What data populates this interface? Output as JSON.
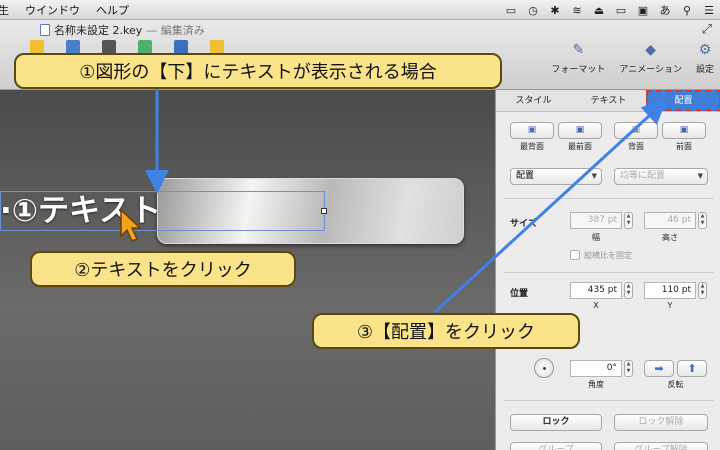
{
  "menubar": {
    "items": [
      "生",
      "ウインドウ",
      "ヘルプ"
    ],
    "status": [
      "▭",
      "◷",
      "✱",
      "≋",
      "⏏",
      "▭",
      "▣",
      "あ",
      "⚲",
      "☰"
    ]
  },
  "window": {
    "doc_title": "名称未設定 2.key",
    "edited": "— 編集済み",
    "fullscreen_glyph": "⤢"
  },
  "toolbar": {
    "left_icon_colors": [
      "#f0c030",
      "#4a7fd0",
      "#555555",
      "#4fb06a",
      "#3a6fc0",
      "#f0c030"
    ],
    "format_label": "フォーマット",
    "animation_label": "アニメーション",
    "settings_label": "設定",
    "format_icon": "✎",
    "animation_icon": "◆",
    "settings_icon": "⚙"
  },
  "canvas": {
    "shape_text": "·①テキスト"
  },
  "panel": {
    "tabs": [
      "スタイル",
      "テキスト",
      "配置"
    ],
    "active_tab": 2,
    "order": {
      "back_label": "最背面",
      "backward_label": "最前面",
      "forward_label": "背面",
      "front_label": "前面"
    },
    "align_dropdown": "配置",
    "distribute_dropdown": "均等に配置",
    "size": {
      "label": "サイズ",
      "width_value": "387 pt",
      "height_value": "46 pt",
      "width_caption": "幅",
      "height_caption": "高さ",
      "constrain_label": "縦横比を固定"
    },
    "position": {
      "label": "位置",
      "x_value": "435 pt",
      "y_value": "110 pt",
      "x_caption": "X",
      "y_caption": "Y"
    },
    "rotate": {
      "angle_value": "0°",
      "angle_caption": "角度",
      "flip_caption": "反転"
    },
    "lock_label": "ロック",
    "unlock_label": "ロック解除",
    "group_label": "グループ",
    "ungroup_label": "グループ解除"
  },
  "callouts": {
    "c1": "①図形の【下】にテキストが表示される場合",
    "c2": "②テキストをクリック",
    "c3": "③【配置】をクリック"
  },
  "colors": {
    "callout_bg": "#fbe38a",
    "arrow": "#3f82e6",
    "active_tab": "#3f7fd9",
    "highlight": "#e03a1f"
  }
}
